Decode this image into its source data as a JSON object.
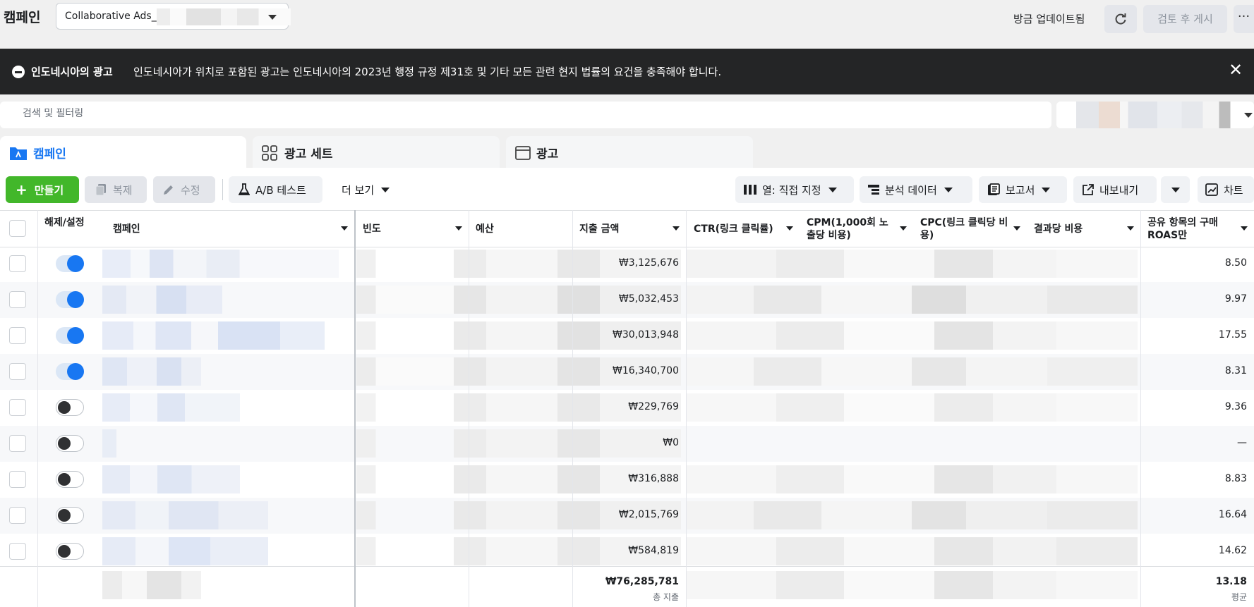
{
  "header": {
    "title": "캠페인",
    "account_name": "Collaborative Ads_I",
    "updated_text": "방금 업데이트됨",
    "publish_label": "검토 후 게시",
    "more_label": "···"
  },
  "banner": {
    "title": "인도네시아의 광고",
    "message": "인도네시아가 위치로 포함된 광고는 인도네시아의 2023년 행정 규정 제31호 및 기타 모든 관련 현지 법률의 요건을 충족해야 합니다.",
    "close_label": "✕"
  },
  "search": {
    "placeholder": "검색 및 필터링"
  },
  "tabs": [
    {
      "label": "캠페인",
      "active": true
    },
    {
      "label": "광고 세트",
      "active": false
    },
    {
      "label": "광고",
      "active": false
    }
  ],
  "toolbar": {
    "create": "만들기",
    "duplicate": "복제",
    "edit": "수정",
    "ab_test": "A/B 테스트",
    "view_more": "더 보기",
    "columns": "열: 직접 지정",
    "breakdown": "분석 데이터",
    "reports": "보고서",
    "export": "내보내기",
    "chart": "차트"
  },
  "columns": {
    "toggle": "해제/설정",
    "campaign": "캠페인",
    "frequency": "빈도",
    "budget": "예산",
    "spend": "지출 금액",
    "ctr": "CTR(링크 클릭률)",
    "cpm": "CPM(1,000회 노출당 비용)",
    "cpc": "CPC(링크 클릭당 비용)",
    "cost_per_result": "결과당 비용",
    "roas": "공유 항목의 구매 ROAS만"
  },
  "rows": [
    {
      "on": true,
      "spend": "₩3,125,676",
      "roas": "8.50"
    },
    {
      "on": true,
      "spend": "₩5,032,453",
      "roas": "9.97"
    },
    {
      "on": true,
      "spend": "₩30,013,948",
      "roas": "17.55"
    },
    {
      "on": true,
      "spend": "₩16,340,700",
      "roas": "8.31"
    },
    {
      "on": false,
      "spend": "₩229,769",
      "roas": "9.36"
    },
    {
      "on": false,
      "spend": "₩0",
      "roas": "—"
    },
    {
      "on": false,
      "spend": "₩316,888",
      "roas": "8.83"
    },
    {
      "on": false,
      "spend": "₩2,015,769",
      "roas": "16.64"
    },
    {
      "on": false,
      "spend": "₩584,819",
      "roas": "14.62"
    }
  ],
  "totals": {
    "spend": "₩76,285,781",
    "spend_label": "총 지출",
    "roas": "13.18",
    "roas_label": "평균"
  },
  "colors": {
    "accent": "#1877f2",
    "create_green": "#42b72a",
    "banner_bg": "#242526"
  }
}
